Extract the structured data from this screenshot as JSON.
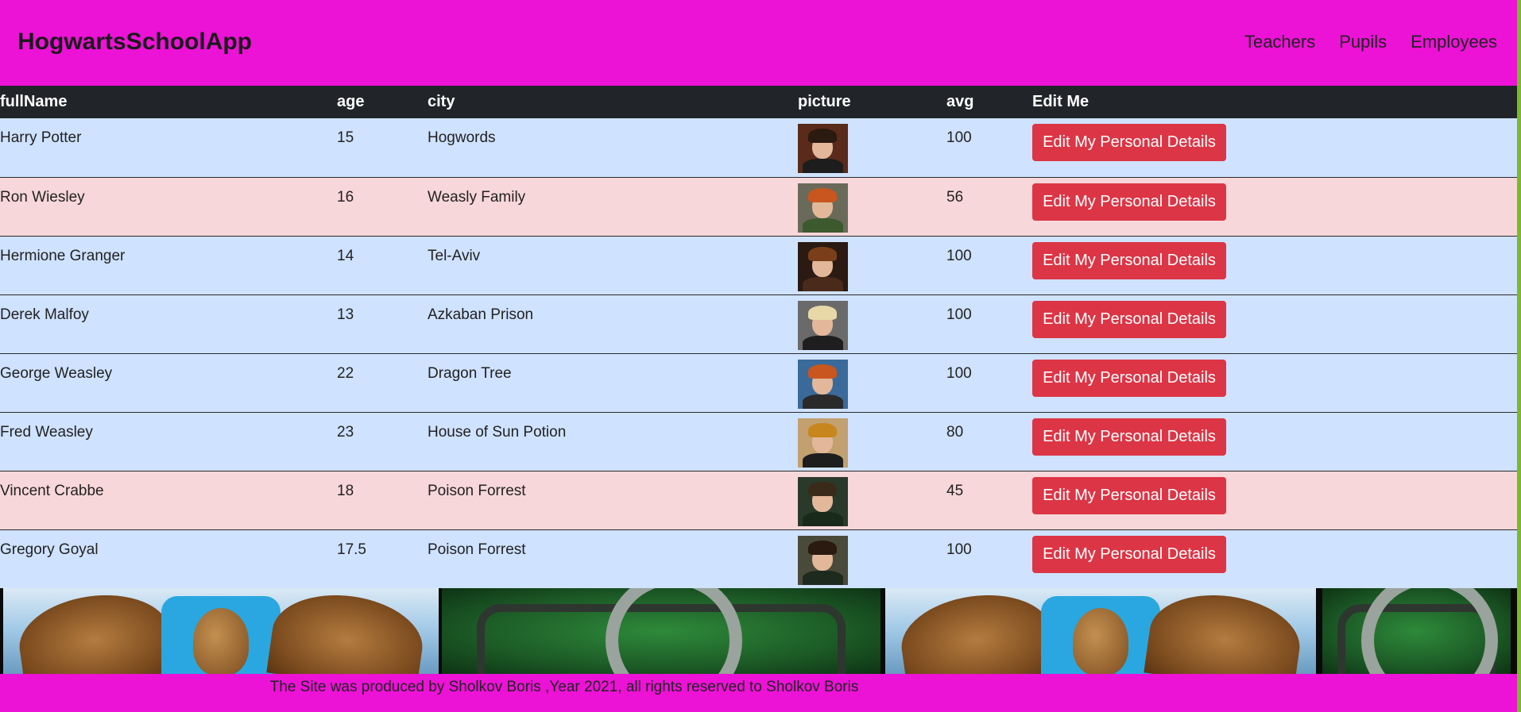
{
  "navbar": {
    "brand": "HogwartsSchoolApp",
    "links": [
      "Teachers",
      "Pupils",
      "Employees"
    ],
    "bg_color": "#ec12d6"
  },
  "table": {
    "headers": [
      "fullName",
      "age",
      "city",
      "picture",
      "avg",
      "Edit Me"
    ],
    "button_label": "Edit My Personal Details",
    "rows": [
      {
        "fullName": "Harry Potter",
        "age": "15",
        "city": "Hogwords",
        "avg": "100",
        "variant": "primary",
        "picture": "harry-potter-portrait"
      },
      {
        "fullName": "Ron Wiesley",
        "age": "16",
        "city": "Weasly Family",
        "avg": "56",
        "variant": "danger",
        "picture": "ron-weasley-portrait"
      },
      {
        "fullName": "Hermione Granger",
        "age": "14",
        "city": "Tel-Aviv",
        "avg": "100",
        "variant": "primary",
        "picture": "hermione-granger-portrait"
      },
      {
        "fullName": "Derek Malfoy",
        "age": "13",
        "city": "Azkaban Prison",
        "avg": "100",
        "variant": "primary",
        "picture": "draco-malfoy-portrait"
      },
      {
        "fullName": "George Weasley",
        "age": "22",
        "city": "Dragon Tree",
        "avg": "100",
        "variant": "primary",
        "picture": "george-weasley-portrait"
      },
      {
        "fullName": "Fred Weasley",
        "age": "23",
        "city": "House of Sun Potion",
        "avg": "80",
        "variant": "primary",
        "picture": "fred-weasley-portrait"
      },
      {
        "fullName": "Vincent Crabbe",
        "age": "18",
        "city": "Poison Forrest",
        "avg": "45",
        "variant": "danger",
        "picture": "vincent-crabbe-portrait"
      },
      {
        "fullName": "Gregory Goyal",
        "age": "17.5",
        "city": "Poison Forrest",
        "avg": "100",
        "variant": "primary",
        "picture": "gregory-goyle-portrait"
      }
    ],
    "colors": {
      "header_bg": "#212529",
      "primary_row": "#cfe2ff",
      "danger_row": "#f8d7da",
      "button_bg": "#dc3545"
    }
  },
  "banner": {
    "tiles": [
      "ravenclaw-eagle-crest",
      "slytherin-snake-crest",
      "ravenclaw-eagle-crest",
      "slytherin-snake-crest"
    ]
  },
  "footer": {
    "text": "The Site was produced by Sholkov Boris ,Year 2021, all rights reserved to Sholkov Boris"
  }
}
